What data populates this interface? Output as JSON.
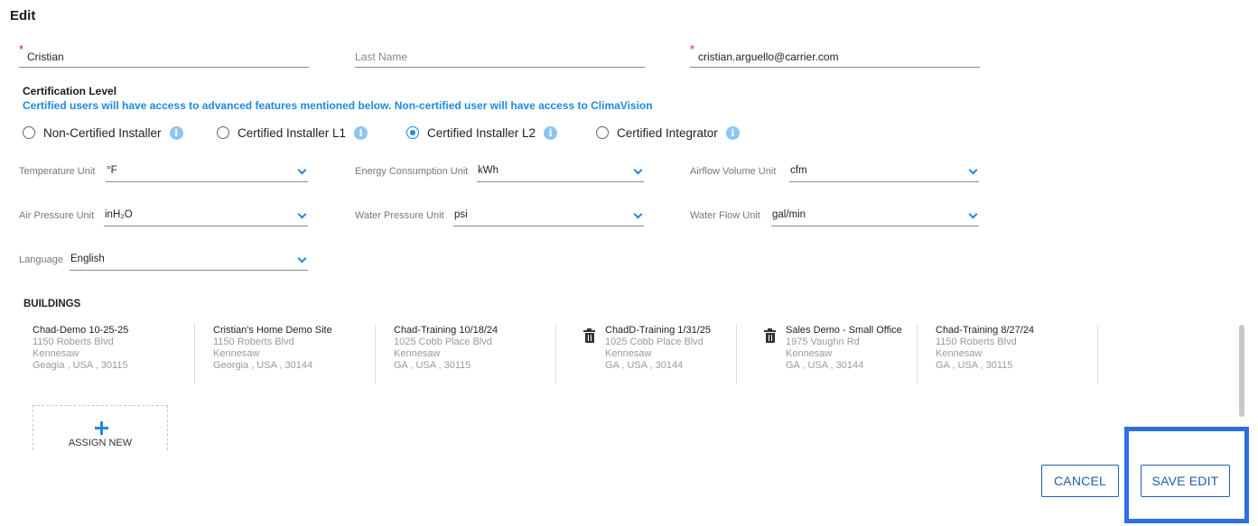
{
  "page": {
    "title": "Edit"
  },
  "user": {
    "first_name": "Cristian",
    "last_name_placeholder": "Last Name",
    "email": "cristian.arguello@carrier.com"
  },
  "certification": {
    "heading": "Certification Level",
    "description": "Certified users will have access to advanced features mentioned below. Non-certified user will have access to ClimaVision",
    "options": [
      {
        "label": "Non-Certified Installer",
        "selected": false
      },
      {
        "label": "Certified Installer L1",
        "selected": false
      },
      {
        "label": "Certified Installer L2",
        "selected": true
      },
      {
        "label": "Certified Integrator",
        "selected": false
      }
    ],
    "info_icon_glyph": "i"
  },
  "units": {
    "temperature": {
      "label": "Temperature Unit",
      "value": "°F"
    },
    "energy": {
      "label": "Energy Consumption Unit",
      "value": "kWh"
    },
    "airflow": {
      "label": "Airflow Volume Unit",
      "value": "cfm"
    },
    "air_pressure": {
      "label": "Air Pressure Unit",
      "value": "inH₂O"
    },
    "water_pressure": {
      "label": "Water Pressure Unit",
      "value": "psi"
    },
    "water_flow": {
      "label": "Water Flow Unit",
      "value": "gal/min"
    },
    "language": {
      "label": "Language",
      "value": "English"
    }
  },
  "buildings": {
    "title": "BUILDINGS",
    "items": [
      {
        "name": "Chad-Demo 10-25-25",
        "street": "1150 Roberts Blvd",
        "city": "Kennesaw",
        "region": "Geagia , USA , 30115",
        "deletable": false
      },
      {
        "name": "Cristian's Home Demo Site",
        "street": "1150 Roberts Blvd",
        "city": "Kennesaw",
        "region": "Georgia , USA , 30144",
        "deletable": false
      },
      {
        "name": "Chad-Training 10/18/24",
        "street": "1025 Cobb Place Blvd",
        "city": "Kennesaw",
        "region": "GA , USA , 30115",
        "deletable": false
      },
      {
        "name": "ChadD-Training 1/31/25",
        "street": "1025 Cobb Place Blvd",
        "city": "Kennesaw",
        "region": "GA , USA , 30144",
        "deletable": true
      },
      {
        "name": "Sales Demo - Small Office",
        "street": "1975 Vaughn Rd",
        "city": "Kennesaw",
        "region": "GA , USA , 30144",
        "deletable": true
      },
      {
        "name": "Chad-Training 8/27/24",
        "street": "1150 Roberts Blvd",
        "city": "Kennesaw",
        "region": "GA , USA , 30115",
        "deletable": false
      }
    ],
    "assign_label": "ASSIGN NEW"
  },
  "actions": {
    "cancel": "CANCEL",
    "save": "SAVE EDIT"
  },
  "colors": {
    "accent": "#1e88e5",
    "button_border": "#1e5fa8",
    "highlight": "#2f6fe0",
    "required": "#e02020"
  }
}
